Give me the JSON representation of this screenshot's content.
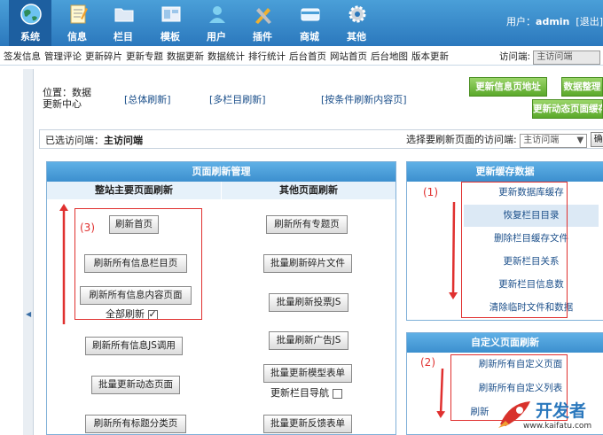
{
  "nav": {
    "items": [
      {
        "label": "系统",
        "icon": "globe-icon"
      },
      {
        "label": "信息",
        "icon": "notepad-icon"
      },
      {
        "label": "栏目",
        "icon": "folder-icon"
      },
      {
        "label": "模板",
        "icon": "template-icon"
      },
      {
        "label": "用户",
        "icon": "user-icon"
      },
      {
        "label": "插件",
        "icon": "tools-icon"
      },
      {
        "label": "商城",
        "icon": "card-icon"
      },
      {
        "label": "其他",
        "icon": "gear-icon"
      }
    ],
    "user_label": "用户：",
    "user_name": "admin",
    "logout": "[退出]"
  },
  "submenu": {
    "links": [
      "签发信息",
      "管理评论",
      "更新碎片",
      "更新专题",
      "数据更新",
      "数据统计",
      "排行统计",
      "后台首页",
      "网站首页",
      "后台地图",
      "版本更新"
    ],
    "visit_label": "访问端:",
    "visit_value": "主访问端"
  },
  "location": {
    "text": "位置：数据更新中心",
    "links": [
      "[总体刷新]",
      "[多栏目刷新]",
      "[按条件刷新内容页]"
    ]
  },
  "green_buttons": {
    "refresh_url": "更新信息页地址",
    "data_organize": "数据整理",
    "dynamic_page": "更新动态页面缓存"
  },
  "visited": {
    "label": "已选访问端：",
    "value": "主访问端",
    "select_label": "选择要刷新页面的访问端:",
    "select_value": "主访问端",
    "confirm": "确"
  },
  "refresh_panel": {
    "title": "页面刷新管理",
    "left_head": "整站主要页面刷新",
    "right_head": "其他页面刷新",
    "left_buttons": [
      "刷新首页",
      "刷新所有信息栏目页",
      "刷新所有信息内容页面",
      "刷新所有信息JS调用",
      "批量更新动态页面",
      "刷新所有标题分类页"
    ],
    "full_refresh": "全部刷新",
    "right_buttons": [
      "刷新所有专题页",
      "批量刷新碎片文件",
      "批量刷新投票JS",
      "批量刷新广告JS",
      "批量更新模型表单",
      "批量更新反馈表单"
    ],
    "nav_update": "更新栏目导航"
  },
  "cache_panel": {
    "title": "更新缓存数据",
    "items": [
      "更新数据库缓存",
      "恢复栏目目录",
      "删除栏目缓存文件",
      "更新栏目关系",
      "更新栏目信息数",
      "清除临时文件和数据"
    ]
  },
  "custom_panel": {
    "title": "自定义页面刷新",
    "items": [
      "刷新所有自定义页面",
      "刷新所有自定义列表",
      "刷新"
    ]
  },
  "annotations": {
    "a1": "(1)",
    "a2": "(2)",
    "a3": "(3)"
  },
  "watermark": {
    "brand": "开发者",
    "url": "www.kaifatu.com"
  },
  "colors": {
    "nav_bg": "#2b78bd",
    "panel_head": "#3c8fce",
    "green_button": "#5aa82a",
    "annotation_red": "#e0302f"
  }
}
